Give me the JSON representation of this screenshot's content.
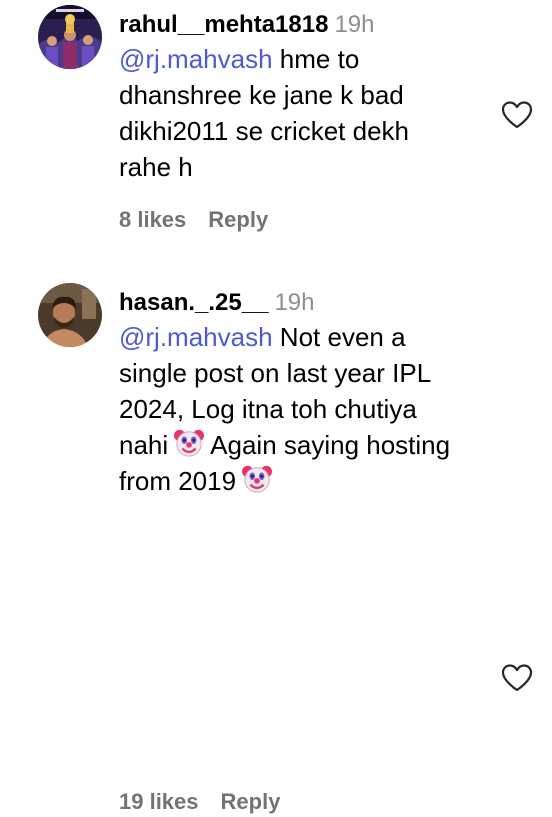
{
  "comments": [
    {
      "username": "rahul__mehta1818",
      "time": "19h",
      "mention": "@rj.mahvash",
      "text_lines": [
        "hme to",
        "dhanshree ke jane k bad",
        "dikhi2011 se cricket dekh",
        "rahe h"
      ],
      "likes": "8 likes",
      "reply": "Reply",
      "avatar_icon": "avatar-image",
      "like_icon": "heart-outline-icon"
    },
    {
      "username": "hasan._.25__",
      "time": "19h",
      "mention": "@rj.mahvash",
      "text_line1": "Not even a",
      "text_line2": "single post on last year IPL",
      "text_line3": "2024, Log itna toh chutiya",
      "text_line4a": "nahi",
      "text_line4b": "Again saying hosting",
      "text_line5": "from 2019",
      "emoji_icon": "clown-face-icon",
      "likes": "19 likes",
      "reply": "Reply",
      "avatar_icon": "avatar-image",
      "like_icon": "heart-outline-icon"
    }
  ]
}
